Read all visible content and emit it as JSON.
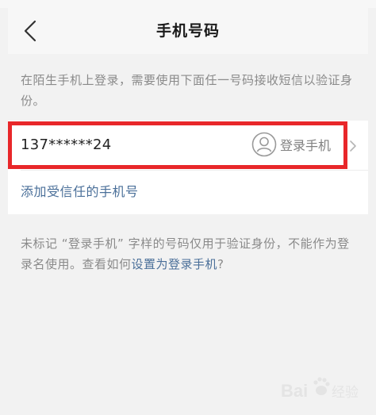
{
  "header": {
    "title": "手机号码"
  },
  "intro_text": "在陌生手机上登录，需要使用下面任一号码接收短信以验证身份。",
  "phone": {
    "number": "137******24",
    "login_badge": "登录手机"
  },
  "add_trusted_label": "添加受信任的手机号",
  "note": {
    "text": "未标记 “登录手机” 字样的号码仅用于验证身份，不能作为登录名使用。查看如何",
    "link": "设置为登录手机",
    "suffix": "?"
  },
  "watermark": {
    "brand": "Bai",
    "suffix": "经验"
  },
  "colors": {
    "link": "#4a6f99",
    "highlight": "#e8272a",
    "background": "#f2f2f2"
  },
  "icons": {
    "back": "chevron-left-icon",
    "user": "user-circle-icon",
    "arrow": "chevron-right-icon"
  }
}
